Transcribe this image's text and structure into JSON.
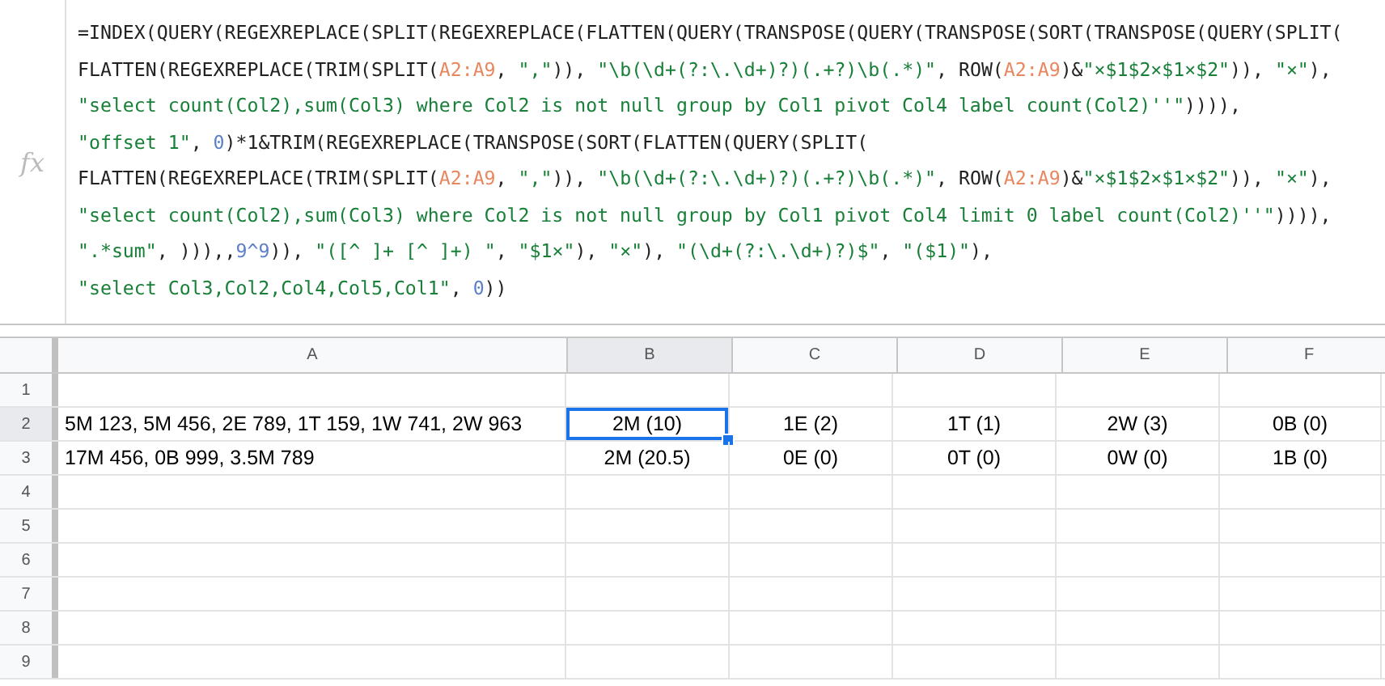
{
  "formula_bar": {
    "label": "fx",
    "lines": [
      [
        {
          "kind": "plain",
          "text": "=INDEX(QUERY(REGEXREPLACE(SPLIT(REGEXREPLACE(FLATTEN(QUERY(TRANSPOSE(QUERY(TRANSPOSE(SORT(TRANSPOSE(QUERY(SPLIT("
        }
      ],
      [
        {
          "kind": "plain",
          "text": "FLATTEN(REGEXREPLACE(TRIM(SPLIT("
        },
        {
          "kind": "range",
          "text": "A2:A9"
        },
        {
          "kind": "plain",
          "text": ", "
        },
        {
          "kind": "string",
          "text": "\",\""
        },
        {
          "kind": "plain",
          "text": ")), "
        },
        {
          "kind": "string",
          "text": "\"\\b(\\d+(?:\\.\\d+)?)(.+?)\\b(.*)\""
        },
        {
          "kind": "plain",
          "text": ", ROW("
        },
        {
          "kind": "range",
          "text": "A2:A9"
        },
        {
          "kind": "plain",
          "text": ")&"
        },
        {
          "kind": "string",
          "text": "\"×$1$2×$1×$2\""
        },
        {
          "kind": "plain",
          "text": ")), "
        },
        {
          "kind": "string",
          "text": "\"×\""
        },
        {
          "kind": "plain",
          "text": "),"
        }
      ],
      [
        {
          "kind": "string",
          "text": "\"select count(Col2),sum(Col3) where Col2 is not null group by Col1 pivot Col4 label count(Col2)''\""
        },
        {
          "kind": "plain",
          "text": ")))),"
        }
      ],
      [
        {
          "kind": "string",
          "text": "\"offset 1\""
        },
        {
          "kind": "plain",
          "text": ", "
        },
        {
          "kind": "number",
          "text": "0"
        },
        {
          "kind": "plain",
          "text": ")*1&TRIM(REGEXREPLACE(TRANSPOSE(SORT(FLATTEN(QUERY(SPLIT("
        }
      ],
      [
        {
          "kind": "plain",
          "text": "FLATTEN(REGEXREPLACE(TRIM(SPLIT("
        },
        {
          "kind": "range",
          "text": "A2:A9"
        },
        {
          "kind": "plain",
          "text": ", "
        },
        {
          "kind": "string",
          "text": "\",\""
        },
        {
          "kind": "plain",
          "text": ")), "
        },
        {
          "kind": "string",
          "text": "\"\\b(\\d+(?:\\.\\d+)?)(.+?)\\b(.*)\""
        },
        {
          "kind": "plain",
          "text": ", ROW("
        },
        {
          "kind": "range",
          "text": "A2:A9"
        },
        {
          "kind": "plain",
          "text": ")&"
        },
        {
          "kind": "string",
          "text": "\"×$1$2×$1×$2\""
        },
        {
          "kind": "plain",
          "text": ")), "
        },
        {
          "kind": "string",
          "text": "\"×\""
        },
        {
          "kind": "plain",
          "text": "),"
        }
      ],
      [
        {
          "kind": "string",
          "text": "\"select count(Col2),sum(Col3) where Col2 is not null group by Col1 pivot Col4 limit 0 label count(Col2)''\""
        },
        {
          "kind": "plain",
          "text": ")))),"
        }
      ],
      [
        {
          "kind": "string",
          "text": "\".*sum\""
        },
        {
          "kind": "plain",
          "text": ", ))),,"
        },
        {
          "kind": "number",
          "text": "9^9"
        },
        {
          "kind": "plain",
          "text": ")), "
        },
        {
          "kind": "string",
          "text": "\"([^ ]+ [^ ]+) \""
        },
        {
          "kind": "plain",
          "text": ", "
        },
        {
          "kind": "string",
          "text": "\"$1×\""
        },
        {
          "kind": "plain",
          "text": "), "
        },
        {
          "kind": "string",
          "text": "\"×\""
        },
        {
          "kind": "plain",
          "text": "), "
        },
        {
          "kind": "string",
          "text": "\"(\\d+(?:\\.\\d+)?)$\""
        },
        {
          "kind": "plain",
          "text": ", "
        },
        {
          "kind": "string",
          "text": "\"($1)\""
        },
        {
          "kind": "plain",
          "text": "),"
        }
      ],
      [
        {
          "kind": "string",
          "text": "\"select Col3,Col2,Col4,Col5,Col1\""
        },
        {
          "kind": "plain",
          "text": ", "
        },
        {
          "kind": "number",
          "text": "0"
        },
        {
          "kind": "plain",
          "text": "))"
        }
      ]
    ]
  },
  "sheet": {
    "columns": [
      "A",
      "B",
      "C",
      "D",
      "E",
      "F"
    ],
    "rows": [
      {
        "number": "1",
        "cells": []
      },
      {
        "number": "2",
        "cells": [
          {
            "text": "5M 123, 5M 456, 2E 789, 1T 159, 1W 741, 2W 963",
            "selected": false
          },
          {
            "text": "2M (10)",
            "selected": true
          },
          {
            "text": "1E (2)",
            "selected": false
          },
          {
            "text": "1T (1)",
            "selected": false
          },
          {
            "text": "2W (3)",
            "selected": false
          },
          {
            "text": "0B (0)",
            "selected": false
          }
        ]
      },
      {
        "number": "3",
        "cells": [
          {
            "text": "17M 456, 0B 999, 3.5M 789",
            "selected": false
          },
          {
            "text": "2M (20.5)",
            "selected": false
          },
          {
            "text": "0E (0)",
            "selected": false
          },
          {
            "text": "0T (0)",
            "selected": false
          },
          {
            "text": "0W (0)",
            "selected": false
          },
          {
            "text": "1B (0)",
            "selected": false
          }
        ]
      },
      {
        "number": "4",
        "cells": []
      },
      {
        "number": "5",
        "cells": []
      },
      {
        "number": "6",
        "cells": []
      },
      {
        "number": "7",
        "cells": []
      },
      {
        "number": "8",
        "cells": []
      },
      {
        "number": "9",
        "cells": []
      }
    ]
  }
}
